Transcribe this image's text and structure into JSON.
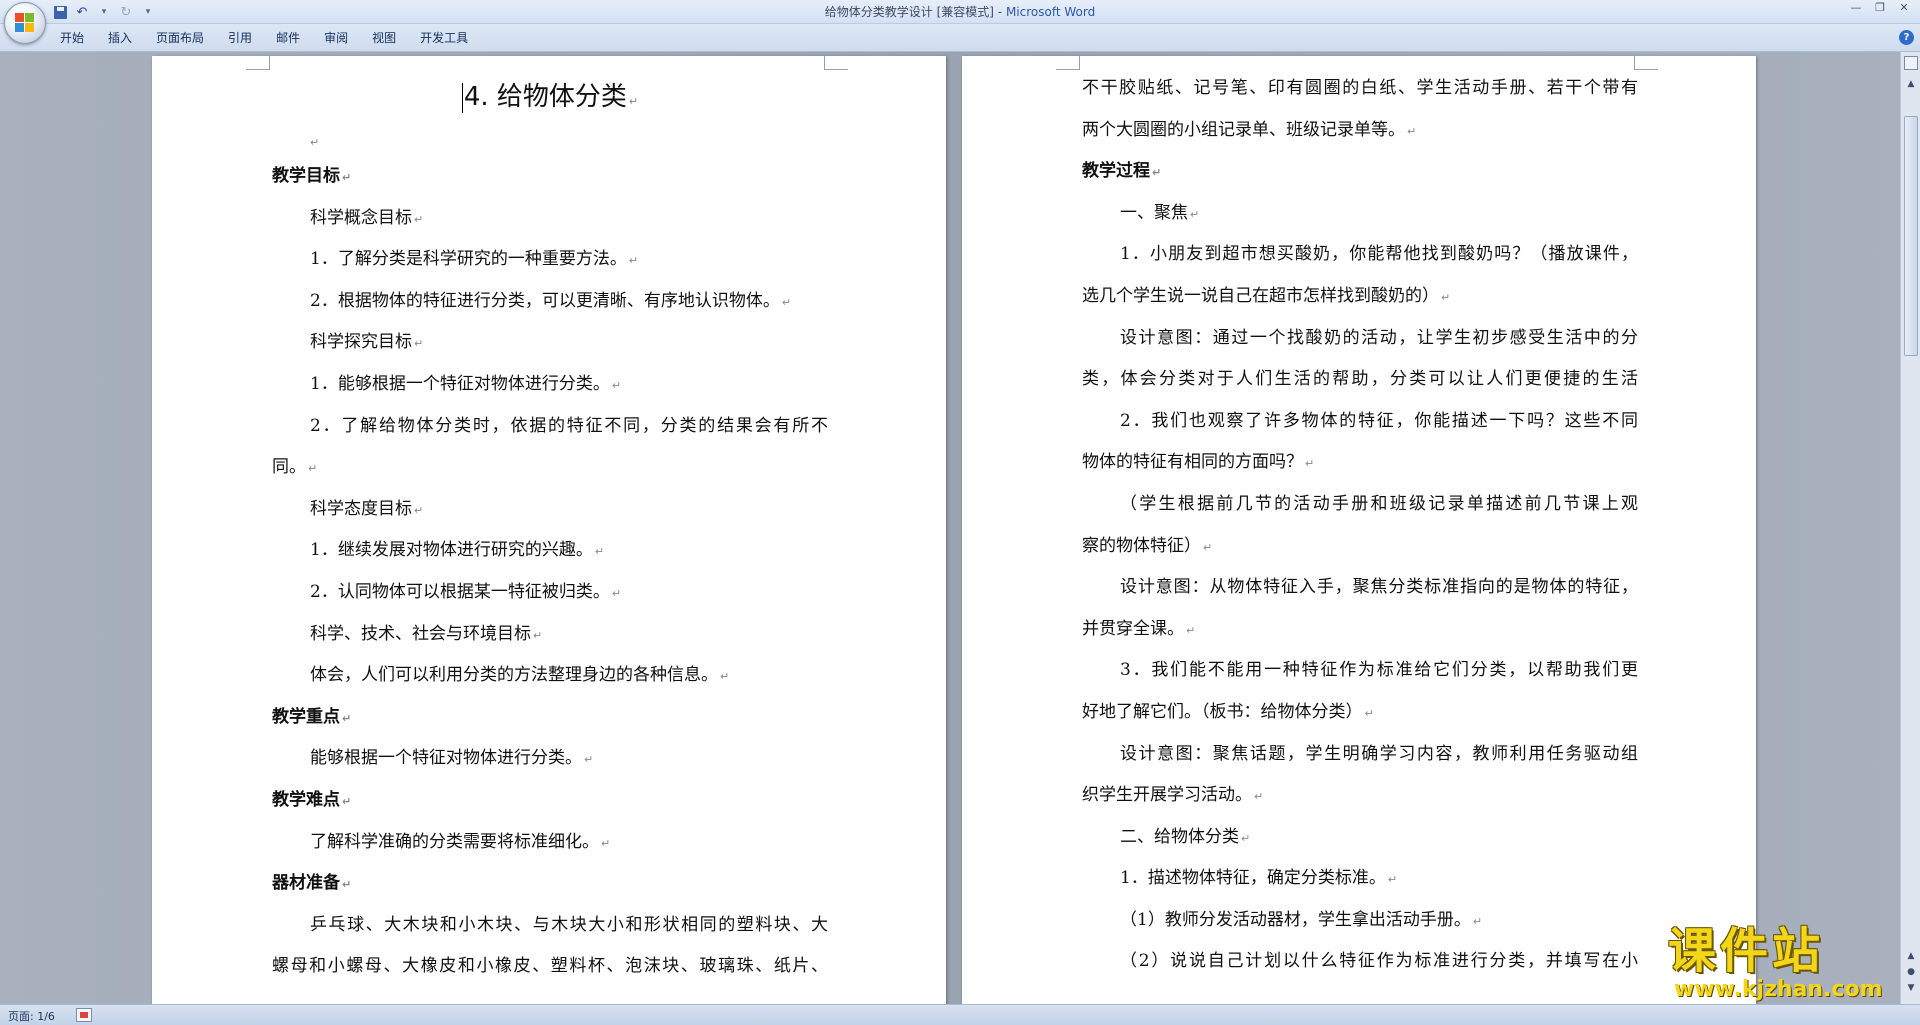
{
  "window": {
    "doc_name": "给物体分类教学设计 [兼容模式]",
    "separator": " - ",
    "app_name": "Microsoft Word"
  },
  "ribbon": {
    "tabs": [
      "开始",
      "插入",
      "页面布局",
      "引用",
      "邮件",
      "审阅",
      "视图",
      "开发工具"
    ]
  },
  "status": {
    "page": "页面: 1/6"
  },
  "watermark": {
    "logo_text": "课件站",
    "url": "www.kjzhan.com"
  },
  "left_page": {
    "title": "4. 给物体分类",
    "lines": [
      {
        "style": "head",
        "text": "教学目标"
      },
      {
        "style": "indent",
        "text": "科学概念目标"
      },
      {
        "style": "indent",
        "text": "1．了解分类是科学研究的一种重要方法。"
      },
      {
        "style": "indent",
        "text": "2．根据物体的特征进行分类，可以更清晰、有序地认识物体。"
      },
      {
        "style": "indent",
        "text": "科学探究目标"
      },
      {
        "style": "indent",
        "text": "1．能够根据一个特征对物体进行分类。"
      },
      {
        "style": "indent justify",
        "text": "2．了解给物体分类时，依据的特征不同，分类的结果会有所不"
      },
      {
        "style": "plain",
        "text": "同。"
      },
      {
        "style": "indent",
        "text": "科学态度目标"
      },
      {
        "style": "indent",
        "text": "1．继续发展对物体进行研究的兴趣。"
      },
      {
        "style": "indent",
        "text": "2．认同物体可以根据某一特征被归类。"
      },
      {
        "style": "indent",
        "text": "科学、技术、社会与环境目标"
      },
      {
        "style": "indent",
        "text": "体会，人们可以利用分类的方法整理身边的各种信息。"
      },
      {
        "style": "head",
        "text": "教学重点"
      },
      {
        "style": "indent",
        "text": "能够根据一个特征对物体进行分类。"
      },
      {
        "style": "head",
        "text": "教学难点"
      },
      {
        "style": "indent",
        "text": "了解科学准确的分类需要将标准细化。"
      },
      {
        "style": "head",
        "text": "器材准备"
      },
      {
        "style": "indent justify",
        "text": "乒乓球、大木块和小木块、与木块大小和形状相同的塑料块、大"
      },
      {
        "style": "plain justify",
        "text": "螺母和小螺母、大橡皮和小橡皮、塑料杯、泡沫块、玻璃珠、纸片、"
      }
    ]
  },
  "right_page": {
    "lines": [
      {
        "style": "plain justify",
        "text": "不干胶贴纸、记号笔、印有圆圈的白纸、学生活动手册、若干个带有"
      },
      {
        "style": "plain",
        "text": "两个大圆圈的小组记录单、班级记录单等。"
      },
      {
        "style": "head",
        "text": "教学过程"
      },
      {
        "style": "indent",
        "text": "一、聚焦"
      },
      {
        "style": "indent justify",
        "text": "1．小朋友到超市想买酸奶，你能帮他找到酸奶吗？（播放课件，"
      },
      {
        "style": "plain",
        "text": "选几个学生说一说自己在超市怎样找到酸奶的）"
      },
      {
        "style": "indent justify",
        "text": "设计意图：通过一个找酸奶的活动，让学生初步感受生活中的分"
      },
      {
        "style": "plain justify",
        "text": "类，体会分类对于人们生活的帮助，分类可以让人们更便捷的生活"
      },
      {
        "style": "indent justify",
        "text": "2．我们也观察了许多物体的特征，你能描述一下吗？这些不同"
      },
      {
        "style": "plain",
        "text": "物体的特征有相同的方面吗？"
      },
      {
        "style": "indent justify",
        "text": "（学生根据前几节的活动手册和班级记录单描述前几节课上观"
      },
      {
        "style": "plain",
        "text": "察的物体特征）"
      },
      {
        "style": "indent justify",
        "text": "设计意图：从物体特征入手，聚焦分类标准指向的是物体的特征，"
      },
      {
        "style": "plain",
        "text": "并贯穿全课。"
      },
      {
        "style": "indent justify",
        "text": "3．我们能不能用一种特征作为标准给它们分类，以帮助我们更"
      },
      {
        "style": "plain",
        "text": "好地了解它们。（板书：给物体分类）"
      },
      {
        "style": "indent justify",
        "text": "设计意图：聚焦话题，学生明确学习内容，教师利用任务驱动组"
      },
      {
        "style": "plain",
        "text": "织学生开展学习活动。"
      },
      {
        "style": "indent",
        "text": "二、给物体分类"
      },
      {
        "style": "indent",
        "text": "1．描述物体特征，确定分类标准。"
      },
      {
        "style": "indent",
        "text": "（1）教师分发活动器材，学生拿出活动手册。"
      },
      {
        "style": "indent justify",
        "text": "（2）说说自己计划以什么特征作为标准进行分类，并填写在小"
      }
    ]
  }
}
